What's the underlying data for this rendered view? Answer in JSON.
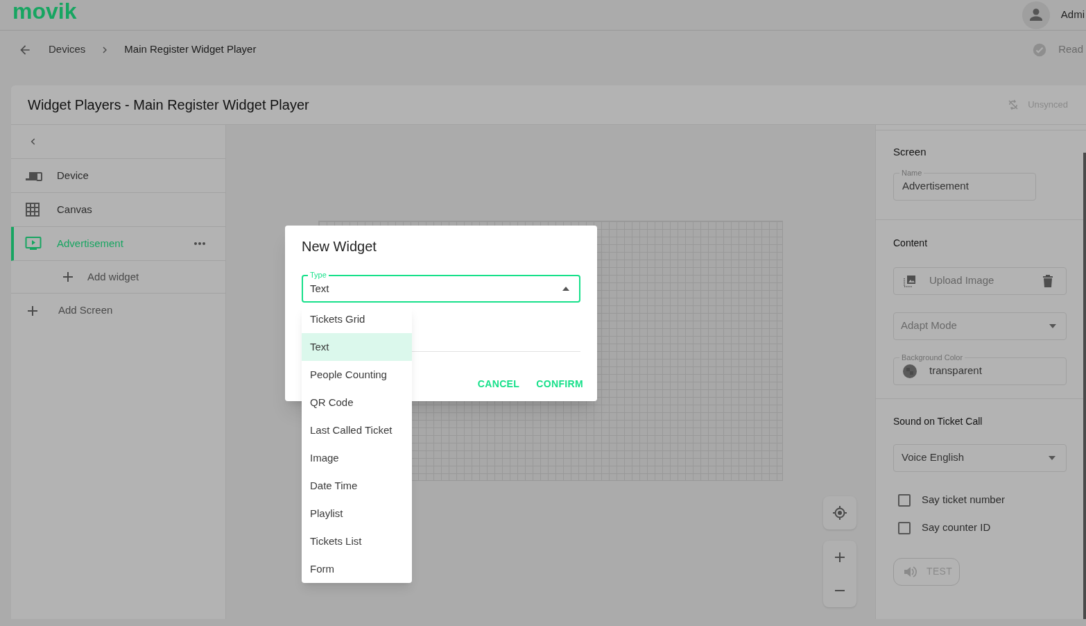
{
  "header": {
    "logo": "movik",
    "user": "Admi"
  },
  "breadcrumb": {
    "items": [
      "Devices",
      "Main Register Widget Player"
    ],
    "status": "Read"
  },
  "page": {
    "title": "Widget Players -  Main Register Widget Player",
    "sync_status": "Unsynced"
  },
  "sidebar": {
    "items": [
      {
        "kind": "device",
        "label": "Device",
        "selected": false
      },
      {
        "kind": "canvas",
        "label": "Canvas",
        "selected": false
      },
      {
        "kind": "screen",
        "label": "Advertisement",
        "selected": true,
        "children": [
          {
            "label": "Add widget"
          }
        ]
      }
    ],
    "add_screen": "Add Screen"
  },
  "properties": {
    "screen": {
      "heading": "Screen",
      "name_label": "Name",
      "name_value": "Advertisement"
    },
    "content": {
      "heading": "Content",
      "upload": "Upload Image",
      "adapt_mode": "Adapt Mode",
      "bg_label": "Background Color",
      "bg_value": "transparent"
    },
    "sound": {
      "heading": "Sound on Ticket Call",
      "voice": "Voice English",
      "checkboxes": [
        {
          "label": "Say ticket number",
          "checked": false
        },
        {
          "label": "Say counter ID",
          "checked": false
        }
      ],
      "test_button": {
        "label": "TEST",
        "disabled": true
      }
    }
  },
  "dialog": {
    "title": "New Widget",
    "type_label": "Type",
    "type_value": "Text",
    "expanded": true,
    "options": [
      {
        "label": "Tickets Grid",
        "selected": false
      },
      {
        "label": "Text",
        "selected": true
      },
      {
        "label": "People Counting",
        "selected": false
      },
      {
        "label": "QR Code",
        "selected": false
      },
      {
        "label": "Last Called Ticket",
        "selected": false
      },
      {
        "label": "Image",
        "selected": false
      },
      {
        "label": "Date Time",
        "selected": false
      },
      {
        "label": "Playlist",
        "selected": false
      },
      {
        "label": "Tickets List",
        "selected": false
      },
      {
        "label": "Form",
        "selected": false
      }
    ],
    "buttons": [
      "CANCEL",
      "CONFIRM"
    ]
  }
}
